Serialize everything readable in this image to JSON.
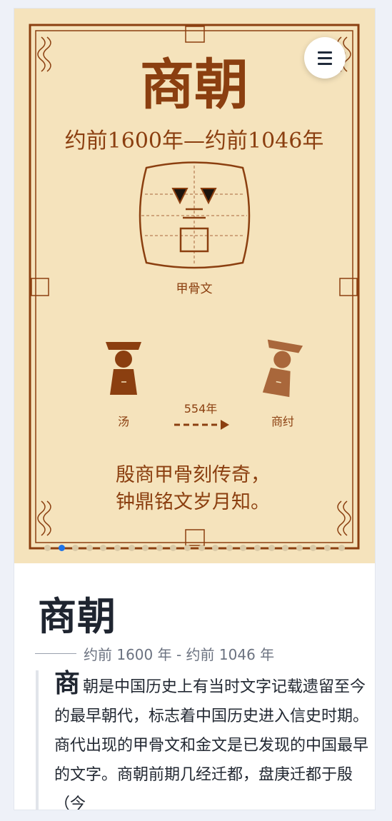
{
  "poster": {
    "title": "商朝",
    "dates": "约前1600年—约前1046年",
    "glyph_caption": "甲骨文",
    "left_figure_label": "汤",
    "right_figure_label": "商纣",
    "span_label": "554年",
    "poem_line1": "殷商甲骨刻传奇，",
    "poem_line2": "钟鼎铭文岁月知。"
  },
  "menu": {
    "icon": "hamburger-menu-icon"
  },
  "carousel": {
    "slide_count": 22,
    "active_index": 1
  },
  "article": {
    "title": "商朝",
    "period": "约前 1600 年 - 约前 1046 年",
    "dropcap": "商",
    "body": "朝是中国历史上有当时文字记载遗留至今的最早朝代，标志着中国历史进入信史时期。商代出现的甲骨文和金文是已发现的中国最早的文字。商朝前期几经迁都，盘庚迁都于殷（今"
  },
  "colors": {
    "poster_bg": "#f5e3bc",
    "brown": "#8b3f10",
    "light_brown": "#a9673b",
    "active_dot": "#1e73e8"
  }
}
